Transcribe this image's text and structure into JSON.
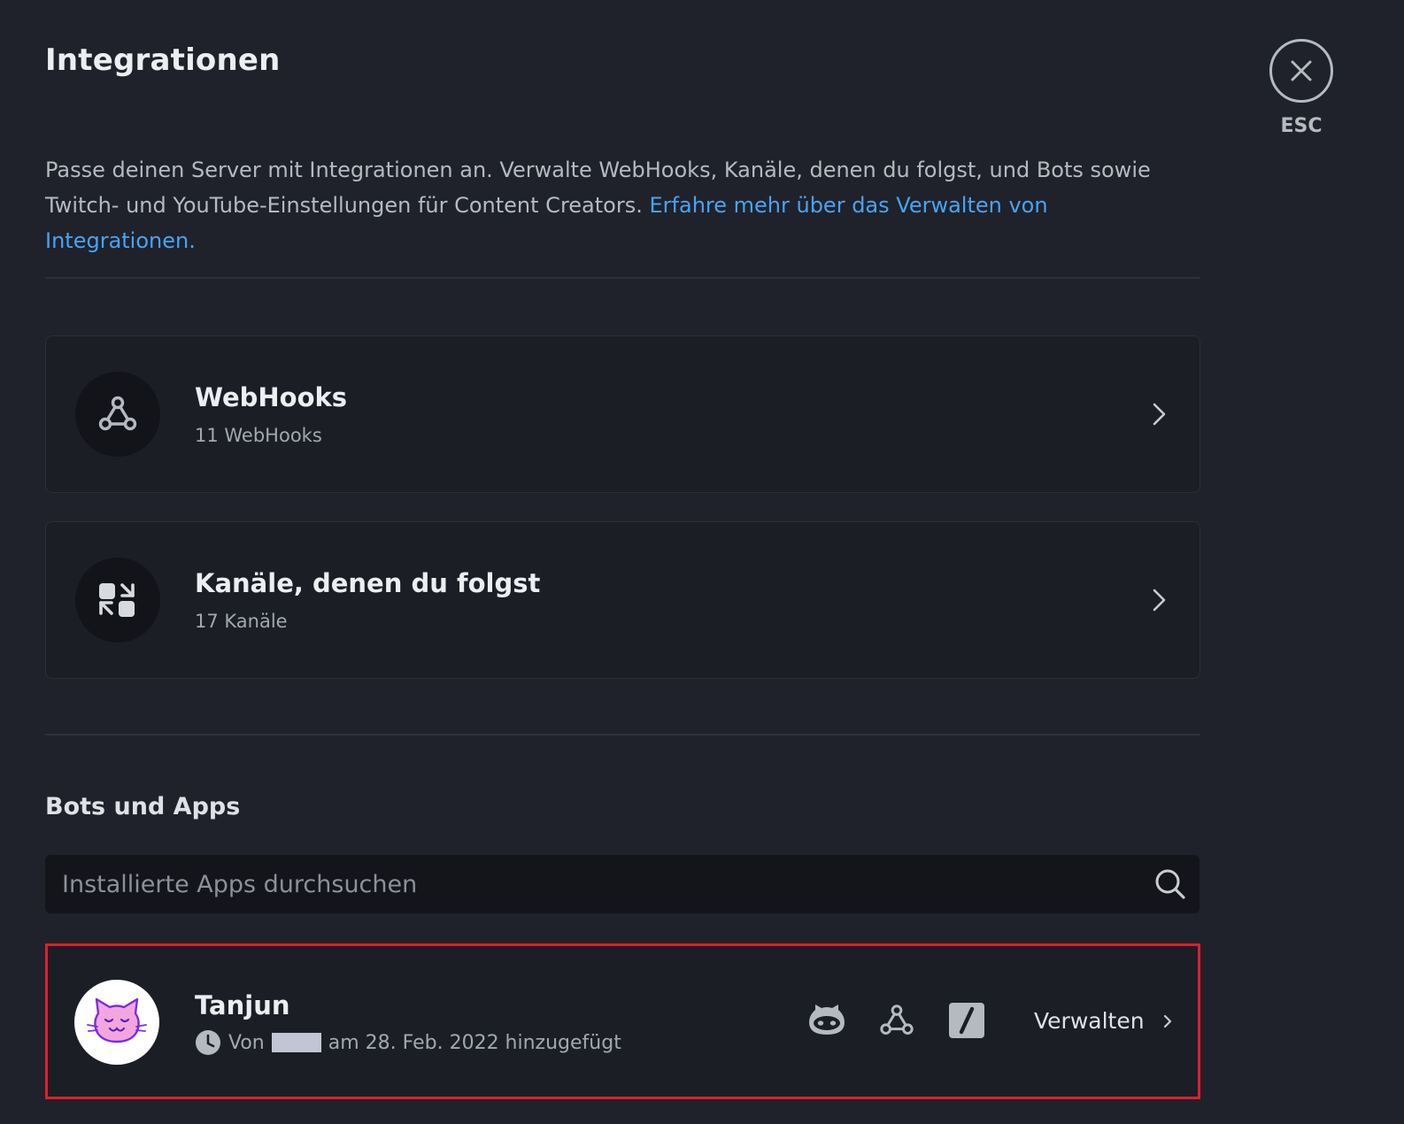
{
  "page": {
    "title": "Integrationen",
    "close_label": "ESC",
    "description": "Passe deinen Server mit Integrationen an. Verwalte WebHooks, Kanäle, denen du folgst, und Bots sowie Twitch- und YouTube-Einstellungen für Content Creators.",
    "learn_more_link": "Erfahre mehr über das Verwalten von Integrationen."
  },
  "cards": [
    {
      "title": "WebHooks",
      "subtitle": "11 WebHooks",
      "icon": "webhook-icon"
    },
    {
      "title": "Kanäle, denen du folgst",
      "subtitle": "17 Kanäle",
      "icon": "followed-channels-icon"
    }
  ],
  "bots": {
    "section_title": "Bots und Apps",
    "search_placeholder": "Installierte Apps durchsuchen",
    "search_value": "",
    "apps": [
      {
        "name": "Tanjun",
        "meta_prefix": "Von",
        "meta_suffix": "am 28. Feb. 2022 hinzugefügt",
        "manage_label": "Verwalten",
        "badges": [
          "bot-icon",
          "webhook-icon",
          "slash-command-icon"
        ]
      }
    ]
  },
  "colors": {
    "background": "#1f222b",
    "card": "#1b1e25",
    "link": "#4aa3f0",
    "highlight_border": "#e01f2d"
  }
}
